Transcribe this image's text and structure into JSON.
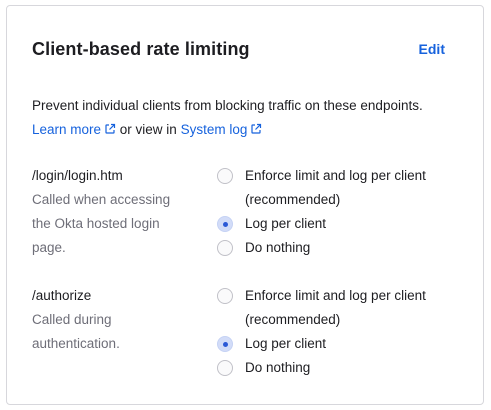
{
  "card": {
    "title": "Client-based rate limiting",
    "edit_label": "Edit",
    "description": "Prevent individual clients from blocking traffic on these endpoints.",
    "learn_more": "Learn more",
    "or_view_in": " or view in ",
    "system_log": "System log"
  },
  "endpoints": [
    {
      "path": "/login/login.htm",
      "description": "Called when accessing the Okta hosted login page.",
      "options": [
        {
          "label": "Enforce limit and log per client (recommended)",
          "checked": false
        },
        {
          "label": "Log per client",
          "checked": true
        },
        {
          "label": "Do nothing",
          "checked": false
        }
      ]
    },
    {
      "path": "/authorize",
      "description": "Called during authentication.",
      "options": [
        {
          "label": "Enforce limit and log per client (recommended)",
          "checked": false
        },
        {
          "label": "Log per client",
          "checked": true
        },
        {
          "label": "Do nothing",
          "checked": false
        }
      ]
    }
  ],
  "colors": {
    "link": "#1662dd",
    "muted_text": "#6e6e78",
    "radio_selected": "#2b59d6",
    "border": "#d7d7dc"
  },
  "icons": {
    "external_link": "external-link-icon"
  }
}
